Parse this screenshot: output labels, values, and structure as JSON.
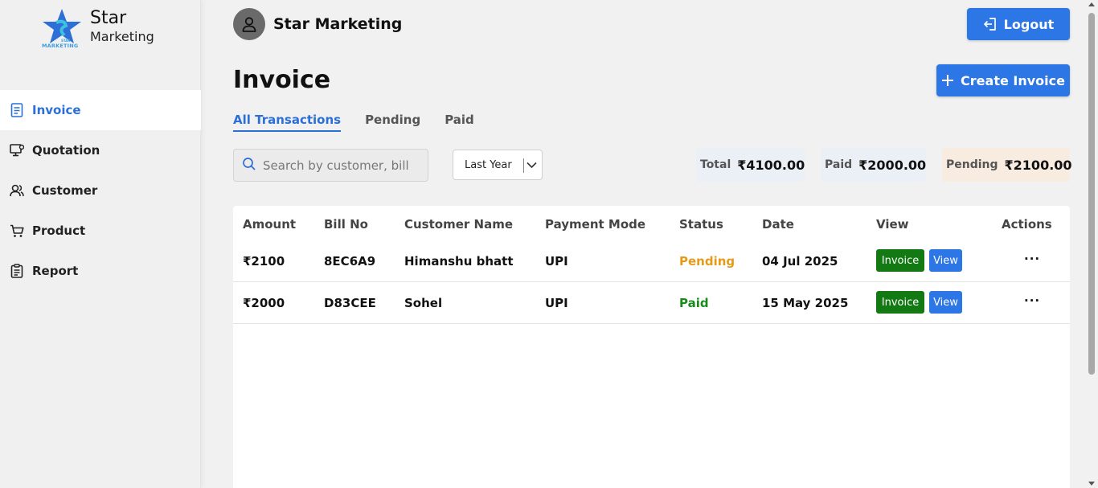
{
  "brand": {
    "name_line1": "Star",
    "name_line2": "Marketing",
    "logo_text": "MARKETING",
    "logo_small": "STAR"
  },
  "sidebar": {
    "items": [
      {
        "label": "Invoice",
        "icon": "document-icon",
        "active": true
      },
      {
        "label": "Quotation",
        "icon": "monitor-icon",
        "active": false
      },
      {
        "label": "Customer",
        "icon": "users-icon",
        "active": false
      },
      {
        "label": "Product",
        "icon": "cart-icon",
        "active": false
      },
      {
        "label": "Report",
        "icon": "clipboard-icon",
        "active": false
      }
    ]
  },
  "header": {
    "user_name": "Star Marketing",
    "logout_label": "Logout"
  },
  "main": {
    "title": "Invoice",
    "create_label": "Create Invoice",
    "tabs": [
      {
        "label": "All Transactions",
        "active": true
      },
      {
        "label": "Pending",
        "active": false
      },
      {
        "label": "Paid",
        "active": false
      }
    ],
    "search": {
      "placeholder": "Search by customer, bill",
      "value": ""
    },
    "period": {
      "selected": "Last Year"
    },
    "stats": {
      "total_label": "Total",
      "total_value": "₹4100.00",
      "paid_label": "Paid",
      "paid_value": "₹2000.00",
      "pending_label": "Pending",
      "pending_value": "₹2100.00"
    }
  },
  "table": {
    "headers": [
      "Amount",
      "Bill No",
      "Customer Name",
      "Payment Mode",
      "Status",
      "Date",
      "View",
      "Actions"
    ],
    "rows": [
      {
        "amount": "₹2100",
        "bill_no": "8EC6A9",
        "customer": "Himanshu bhatt",
        "mode": "UPI",
        "status": "Pending",
        "date": "04 Jul 2025",
        "invoice_label": "Invoice",
        "view_label": "View",
        "actions": "···"
      },
      {
        "amount": "₹2000",
        "bill_no": "D83CEE",
        "customer": "Sohel",
        "mode": "UPI",
        "status": "Paid",
        "date": "15 May 2025",
        "invoice_label": "Invoice",
        "view_label": "View",
        "actions": "···"
      }
    ]
  },
  "colors": {
    "accent": "#2c76e6",
    "pending": "#e59b1a",
    "paid": "#1a8a1a",
    "invoice_chip": "#137a13"
  }
}
